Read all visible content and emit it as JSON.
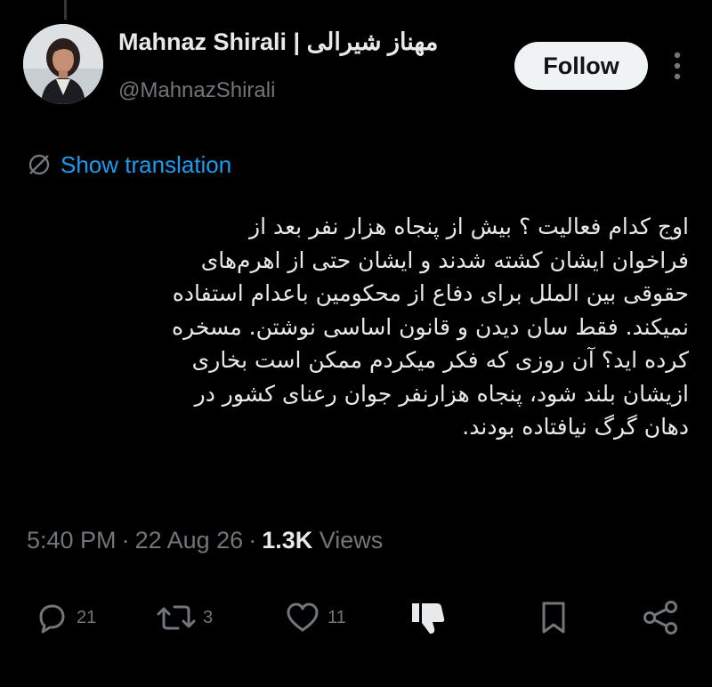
{
  "author": {
    "display_name": "Mahnaz Shirali | مهناز شیرالی",
    "handle": "@MahnazShirali"
  },
  "follow_label": "Follow",
  "show_translation_label": "Show translation",
  "tweet_lines": [
    "اوج کدام فعالیت ؟ بیش از پنجاه هزار نفر بعد از",
    "فراخوان ایشان کشته شدند و ایشان حتی از اهرم‌های",
    "حقوقی بین الملل برای دفاع از محکومین باعدام استفاده",
    "نمیکند. فقط سان دیدن و قانون اساسی نوشتن. مسخره",
    "کرده اید؟ آن روزی که فکر میکردم ممکن است بخاری",
    "ازیشان بلند شود، پنجاه هزارنفر جوان رعنای کشور در",
    "دهان گرگ نیافتاده بودند."
  ],
  "meta": {
    "time": "5:40 PM",
    "date": "22 Aug 26",
    "views_count": "1.3K",
    "views_label": "Views"
  },
  "actions": {
    "reply_count": "21",
    "retweet_count": "3",
    "like_count": "11"
  },
  "colors": {
    "background": "#000000",
    "text_primary": "#e7e9ea",
    "text_secondary": "#71767b",
    "link": "#1d9bf0",
    "follow_bg": "#eff3f4"
  },
  "icons": {
    "translate": "translate-slash-icon",
    "more": "more-vertical-icon",
    "reply": "reply-bubble-icon",
    "retweet": "retweet-icon",
    "like": "heart-icon",
    "dislike": "thumbs-down-icon",
    "bookmark": "bookmark-icon",
    "share": "share-icon"
  }
}
